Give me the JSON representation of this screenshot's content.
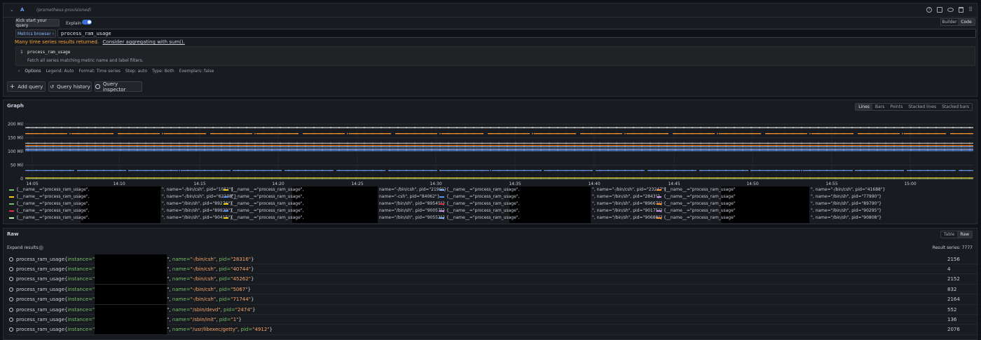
{
  "query": {
    "ref_id": "A",
    "datasource": "(prometheus-provisioned)",
    "kickstart_label": "Kick start your query",
    "explain_label": "Explain",
    "builder_label": "Builder",
    "code_label": "Code",
    "metrics_browser_label": "Metrics browser ›",
    "expression": "process_ram_usage",
    "warning": "Many time series results returned.",
    "warning_link": "Consider aggregating with sum().",
    "suggestion_title": "process_ram_usage",
    "suggestion_desc": "Fetch all series matching metric name and label filters.",
    "options_label": "Options",
    "options": [
      "Legend: Auto",
      "Format: Time series",
      "Step: auto",
      "Type: Both",
      "Exemplars: false"
    ],
    "explain_on": true
  },
  "actions": {
    "add_query": "Add query",
    "query_history": "Query history",
    "query_inspector": "Query inspector"
  },
  "graph": {
    "title": "Graph",
    "modes": [
      "Lines",
      "Bars",
      "Points",
      "Stacked lines",
      "Stacked bars"
    ],
    "active_mode": "Lines"
  },
  "chart_data": {
    "type": "line",
    "y_ticks": [
      "0",
      "50 Mil",
      "100 Mil",
      "150 Mil",
      "200 Mil"
    ],
    "x_ticks": [
      "14:05",
      "14:10",
      "14:15",
      "14:20",
      "14:25",
      "14:30",
      "14:35",
      "14:40",
      "14:45",
      "14:50",
      "14:55",
      "15:00"
    ],
    "ylim": [
      0,
      200
    ],
    "series_levels": [
      {
        "color": "#f2f2f2",
        "value": 187,
        "dashed": false
      },
      {
        "color": "#ff9830",
        "value": 165,
        "dashed": true
      },
      {
        "color": "#c8c8c8",
        "value": 130,
        "dashed": false
      },
      {
        "color": "#ff780a",
        "value": 122,
        "dashed": false
      },
      {
        "color": "#8ab8ff",
        "value": 117,
        "dashed": false
      },
      {
        "color": "#b0c0ff",
        "value": 108,
        "dashed": false
      },
      {
        "color": "#5794f2",
        "value": 103,
        "dashed": false
      },
      {
        "color": "#6e9fff",
        "value": 30,
        "dashed": true
      },
      {
        "color": "#f2cc0c",
        "value": 3,
        "dashed": false
      },
      {
        "color": "#e02f44",
        "value": 1,
        "dashed": false
      },
      {
        "color": "#73bf69",
        "value": 0.5,
        "dashed": false
      }
    ]
  },
  "legend": {
    "columns": [
      [
        {
          "color": "#73bf69",
          "a": "{__name__=\"process_ram_usage\",",
          "b": "\", name=\"-/bin/csh\", pid=\"1051\"}"
        },
        {
          "color": "#f2cc0c",
          "a": "{__name__=\"process_ram_usage\",",
          "b": "\", name=\"-/bin/csh\", pid=\"62108\"}"
        },
        {
          "color": "#73bf69",
          "a": "{__name__=\"process_ram_usage\",",
          "b": "\", name=\"/bin/sh\", pid=\"89276\"}"
        },
        {
          "color": "#e02f44",
          "a": "{__name__=\"process_ram_usage\",",
          "b": "\", name=\"/bin/sh\", pid=\"89929\"}"
        },
        {
          "color": "#c8f2c2",
          "a": "{__name__=\"process_ram_usage\",",
          "b": "\", name=\"/bin/sh\", pid=\"90415\"}"
        }
      ],
      [
        {
          "color": "#f2cc0c",
          "a": "{__name__=\"process_ram_usage\",",
          "b": "name=\"-/bin/csh\", pid=\"2190\"}"
        },
        {
          "color": "#5794f2",
          "a": "{__name__=\"process_ram_usage\",",
          "b": "name=\"-csh\", pid=\"84062\"}"
        },
        {
          "color": "#f2cc0c",
          "a": "{__name__=\"process_ram_usage\",",
          "b": "name=\"/bin/sh\", pid=\"89545\"}"
        },
        {
          "color": "#5794f2",
          "a": "{__name__=\"process_ram_usage\",",
          "b": "name=\"/bin/sh\", pid=\"90057\"}"
        },
        {
          "color": "#f2cc0c",
          "a": "{__name__=\"process_ram_usage\",",
          "b": "name=\"/bin/sh\", pid=\"90552\"}"
        }
      ],
      [
        {
          "color": "#8ab8ff",
          "a": "{__name__=\"process_ram_usage\",",
          "b": "\", name=\"-/bin/csh\", pid=\"23247\"}"
        },
        {
          "color": "#5794f2",
          "a": "{__name__=\"process_ram_usage\",",
          "b": "\", name=\"/bin/sh\", pid=\"2843\"}"
        },
        {
          "color": "#e02f44",
          "a": "{__name__=\"process_ram_usage\",",
          "b": "\", name=\"/bin/sh\", pid=\"89667\"}"
        },
        {
          "color": "#ca95e5",
          "a": "{__name__=\"process_ram_usage\",",
          "b": "\", name=\"/bin/sh\", pid=\"90175\"}"
        },
        {
          "color": "#8ab8ff",
          "a": "{__name__=\"process_ram_usage\",",
          "b": "\", name=\"/bin/sh\", pid=\"90688\"}"
        }
      ],
      [
        {
          "color": "#ff9830",
          "a": "{__name__=\"process_ram_usage\"",
          "b": "\", name=\"-/bin/csh\", pid=\"41688\"}"
        },
        {
          "color": "#ca95e5",
          "a": "{__name__=\"process_ram_usage\"",
          "b": "\", name=\"/bin/sh\", pid=\"77990\"}"
        },
        {
          "color": "#ff9830",
          "a": "{__name__=\"process_ram_usage\"",
          "b": "\", name=\"/bin/sh\", pid=\"89790\"}"
        },
        {
          "color": "#ca95e5",
          "a": "{__name__=\"process_ram_usage\"",
          "b": "\", name=\"/bin/sh\", pid=\"90295\"}"
        },
        {
          "color": "#ff9830",
          "a": "{__name__=\"process_ram_usage\"",
          "b": "\", name=\"/bin/sh\", pid=\"90808\"}"
        }
      ]
    ]
  },
  "raw": {
    "title": "Raw",
    "modes": [
      "Table",
      "Raw"
    ],
    "active_mode": "Raw",
    "expand_label": "Expand results",
    "result_series": "Result series: 7777",
    "rows": [
      {
        "metric": "process_ram_usage{",
        "inst_key": "instance=\"",
        "name_val": "\"-/bin/csh\"",
        "pid_val": "\"28316\"",
        "value": "2156"
      },
      {
        "metric": "process_ram_usage{",
        "inst_key": "instance=\"",
        "name_val": "\"-/bin/csh\"",
        "pid_val": "\"40744\"",
        "value": "4"
      },
      {
        "metric": "process_ram_usage{",
        "inst_key": "instance=\"",
        "name_val": "\"-/bin/csh\"",
        "pid_val": "\"45262\"",
        "value": "2152"
      },
      {
        "metric": "process_ram_usage{",
        "inst_key": "instance=\"",
        "name_val": "\"-/bin/csh\"",
        "pid_val": "\"5067\"",
        "value": "832"
      },
      {
        "metric": "process_ram_usage{",
        "inst_key": "instance=\"",
        "name_val": "\"-/bin/csh\"",
        "pid_val": "\"71744\"",
        "value": "2164"
      },
      {
        "metric": "process_ram_usage{",
        "inst_key": "instance=\"",
        "name_val": "\"/sbin/devd\"",
        "pid_val": "\"2474\"",
        "value": "552"
      },
      {
        "metric": "process_ram_usage{",
        "inst_key": "instance=\"",
        "name_val": "\"/sbin/init\"",
        "pid_val": "\"1\"",
        "value": "136"
      },
      {
        "metric": "process_ram_usage{",
        "inst_key": "instance=\"",
        "name_val": "\"/usr/libexec/getty\"",
        "pid_val": "\"4912\"",
        "value": "2076"
      }
    ]
  }
}
